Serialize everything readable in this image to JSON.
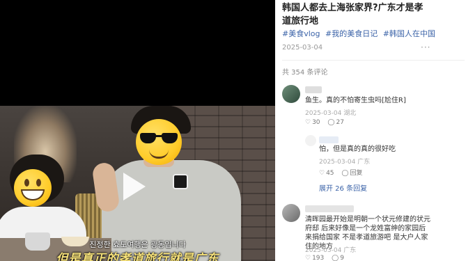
{
  "video": {
    "subtitle_ko": "진정한 효도여행은 광동입니다",
    "subtitle_zh": "但是真正的孝道旅行就是广东"
  },
  "post": {
    "title": "韩国人都去上海张家界?广东才是孝道旅行地",
    "tags": [
      "#美食vlog",
      "#我的美食日记",
      "#韩国人在中国"
    ],
    "date": "2025-03-04"
  },
  "comments": {
    "count_label": "共 354 条评论",
    "items": [
      {
        "text": "鱼生。真的不怕寄生虫吗[尬住R]",
        "date": "2025-03-04",
        "location": "湖北",
        "likes": "30",
        "replies": "27",
        "reply": {
          "text": "怕，但是真的真的很好吃",
          "date": "2025-03-04",
          "location": "广东",
          "likes": "45",
          "reply_label": "回复"
        },
        "expand_label": "展开 26 条回复"
      },
      {
        "text": "清晖园最开始是明朝一个状元修建的状元府邸 后来好像是一个龙姓富绅的家园后来捐给国家 不是孝道旅游吧 是大户人家住的地方",
        "date": "2025-03-04",
        "location": "广东",
        "likes": "193",
        "replies": "9"
      }
    ]
  },
  "icons": {
    "more": "more-dots-icon",
    "like": "heart-icon",
    "reply": "comment-bubble-icon",
    "play": "play-icon"
  },
  "colors": {
    "accent": "#3b63a8",
    "subtitle_zh": "#f7e27a"
  }
}
